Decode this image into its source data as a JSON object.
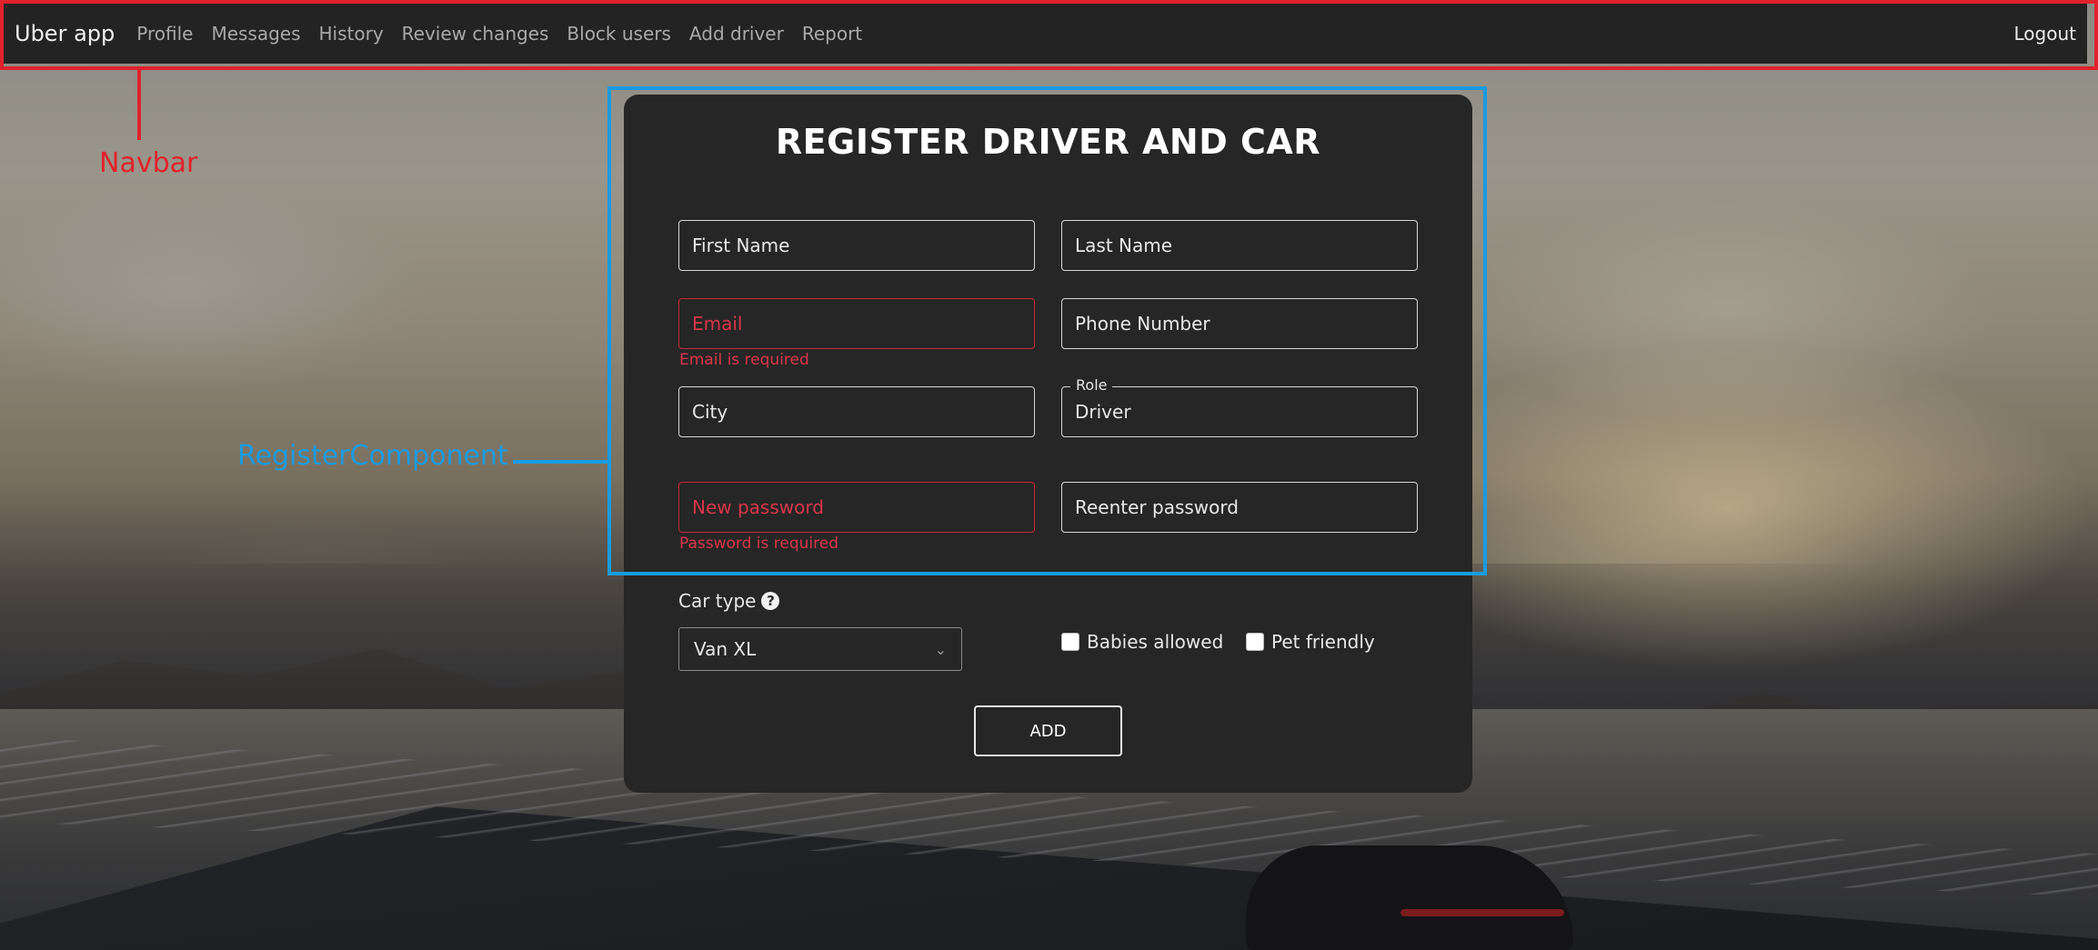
{
  "navbar": {
    "brand": "Uber app",
    "items": [
      "Profile",
      "Messages",
      "History",
      "Review changes",
      "Block users",
      "Add driver",
      "Report"
    ],
    "logout": "Logout"
  },
  "annotations": {
    "navbar": "Navbar",
    "register": "RegisterComponent",
    "navbar_color": "#e0222c",
    "register_color": "#1a9be0"
  },
  "form": {
    "title": "REGISTER DRIVER AND CAR",
    "first_name": "First Name",
    "last_name": "Last Name",
    "email": "Email",
    "email_error": "Email is required",
    "phone": "Phone Number",
    "city": "City",
    "role_label": "Role",
    "role_value": "Driver",
    "new_password": "New password",
    "password_error": "Password is required",
    "reenter_password": "Reenter password",
    "car_type_label": "Car type",
    "car_type_value": "Van XL",
    "babies_allowed": "Babies allowed",
    "pet_friendly": "Pet friendly",
    "add_button": "ADD"
  },
  "icons": {
    "help": "question-circle-icon",
    "chevron": "chevron-down-icon"
  }
}
